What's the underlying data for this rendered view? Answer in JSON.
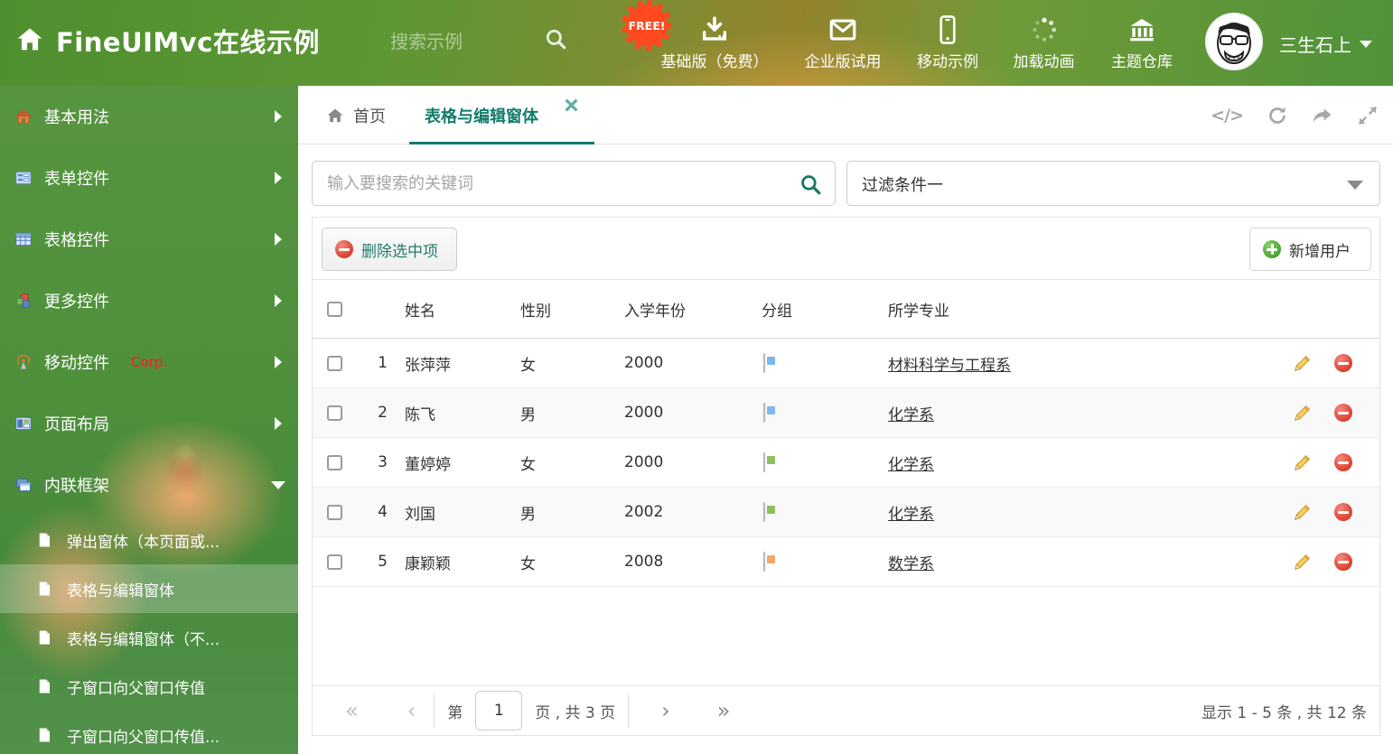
{
  "colors": {
    "accent_teal": "#117c6c",
    "header_green": "#5d9733",
    "free_badge": "#ff4a1f",
    "corp_red": "#ff1a1a",
    "delete_red": "#d93a2b",
    "add_green": "#3fa32e",
    "pencil_yellow": "#f7cf5a"
  },
  "header": {
    "title": "FineUIMvc在线示例",
    "search_placeholder": "搜索示例",
    "free_badge": "FREE!",
    "actions": [
      {
        "icon": "download-icon",
        "label": "基础版（免费）"
      },
      {
        "icon": "envelope-icon",
        "label": "企业版试用"
      },
      {
        "icon": "mobile-icon",
        "label": "移动示例"
      },
      {
        "icon": "spinner-icon",
        "label": "加载动画"
      },
      {
        "icon": "bank-icon",
        "label": "主题仓库"
      }
    ],
    "user": {
      "name": "三生石上"
    }
  },
  "sidebar": {
    "items": [
      {
        "label": "基本用法"
      },
      {
        "label": "表单控件"
      },
      {
        "label": "表格控件"
      },
      {
        "label": "更多控件"
      },
      {
        "label": "移动控件",
        "badge": "Corp."
      },
      {
        "label": "页面布局"
      },
      {
        "label": "内联框架"
      }
    ],
    "subitems": [
      {
        "label": "弹出窗体（本页面或..."
      },
      {
        "label": "表格与编辑窗体"
      },
      {
        "label": "表格与编辑窗体（不..."
      },
      {
        "label": "子窗口向父窗口传值"
      },
      {
        "label": "子窗口向父窗口传值..."
      }
    ]
  },
  "tabs": {
    "home": "首页",
    "active": "表格与编辑窗体"
  },
  "toolbar_icons": {
    "code_glyph": "</>"
  },
  "content": {
    "search_placeholder": "输入要搜索的关键词",
    "filter_value": "过滤条件一",
    "grid": {
      "delete_button": "删除选中项",
      "add_button": "新增用户",
      "columns": {
        "name": "姓名",
        "gender": "性别",
        "year": "入学年份",
        "group": "分组",
        "major": "所学专业"
      },
      "rows": [
        {
          "num": "1",
          "name": "张萍萍",
          "gender": "女",
          "year": "2000",
          "tag_style": "--tag:#7ab8f0",
          "major": "材料科学与工程系"
        },
        {
          "num": "2",
          "name": "陈飞",
          "gender": "男",
          "year": "2000",
          "tag_style": "--tag:#7ab8f0",
          "major": "化学系"
        },
        {
          "num": "3",
          "name": "董婷婷",
          "gender": "女",
          "year": "2000",
          "tag_style": "--tag:#8cbf5e",
          "major": "化学系"
        },
        {
          "num": "4",
          "name": "刘国",
          "gender": "男",
          "year": "2002",
          "tag_style": "--tag:#8cbf5e",
          "major": "化学系"
        },
        {
          "num": "5",
          "name": "康颖颖",
          "gender": "女",
          "year": "2008",
          "tag_style": "--tag:#f2a869",
          "major": "数学系"
        }
      ]
    },
    "pagination": {
      "first": "«",
      "prev": "‹",
      "next": "›",
      "last": "»",
      "page_prefix": "第",
      "page_value": "1",
      "page_suffix": "页 , 共 3 页",
      "summary": "显示 1 - 5 条 , 共 12 条"
    }
  }
}
